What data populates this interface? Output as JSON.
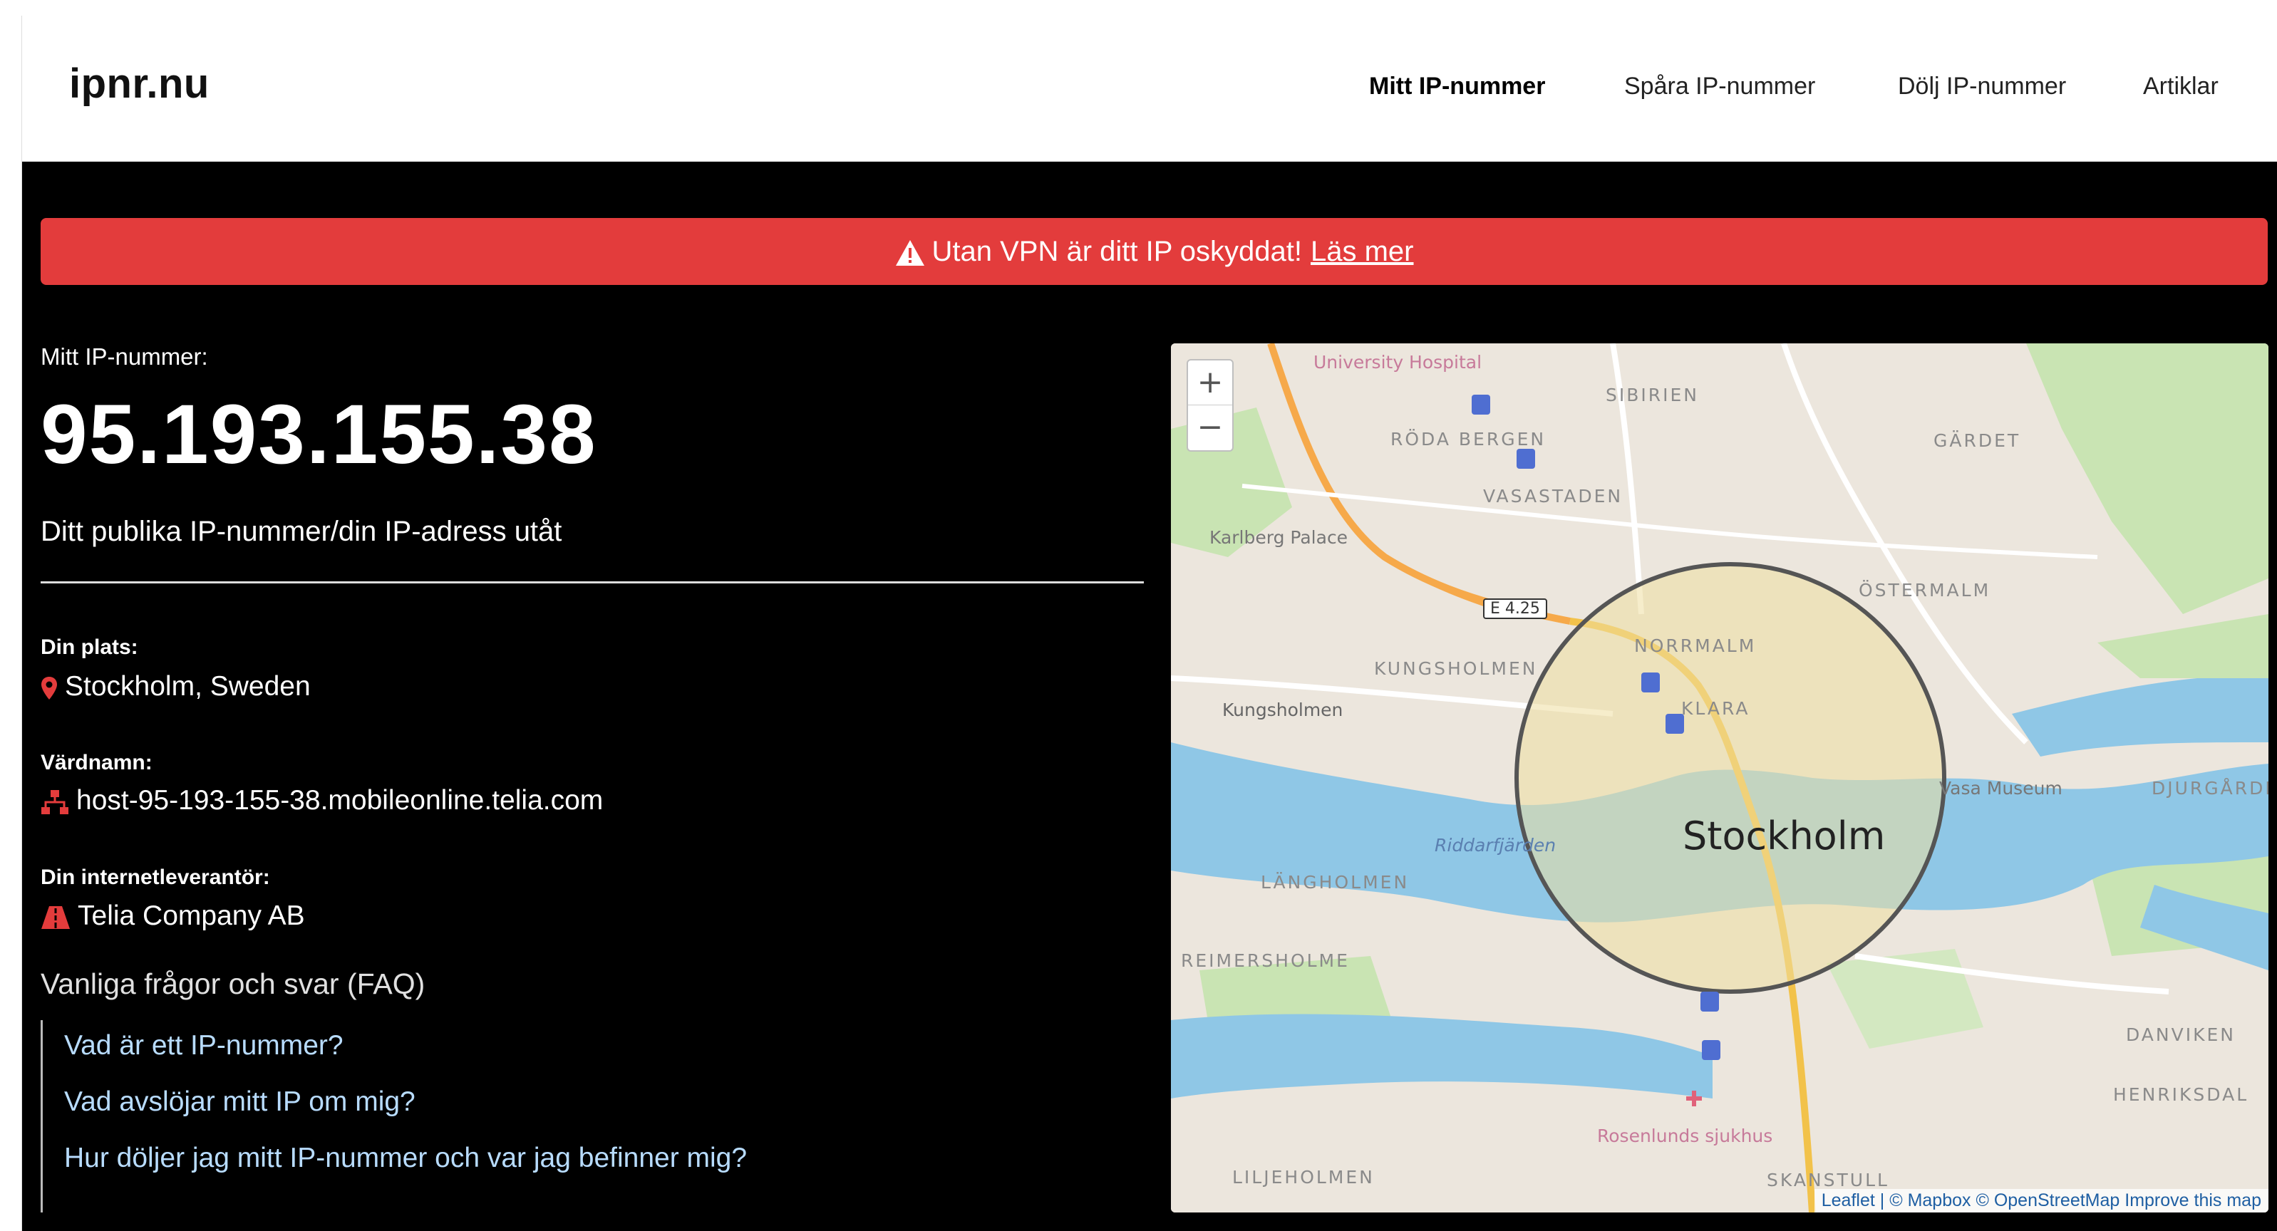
{
  "header": {
    "logo": "ipnr.nu",
    "nav": [
      {
        "label": "Mitt IP-nummer",
        "active": true
      },
      {
        "label": "Spåra IP-nummer",
        "active": false
      },
      {
        "label": "Dölj IP-nummer",
        "active": false
      },
      {
        "label": "Artiklar",
        "active": false
      }
    ]
  },
  "banner": {
    "text": "Utan VPN är ditt IP oskyddat!",
    "link": "Läs mer",
    "icon": "warning-icon",
    "color": "#e33c3c"
  },
  "ip": {
    "label": "Mitt IP-nummer:",
    "value": "95.193.155.38",
    "description": "Ditt publika IP-nummer/din IP-adress utåt"
  },
  "info": [
    {
      "label": "Din plats:",
      "value": "Stockholm, Sweden",
      "icon": "location-pin-icon"
    },
    {
      "label": "Värdnamn:",
      "value": "host-95-193-155-38.mobileonline.telia.com",
      "icon": "network-icon"
    },
    {
      "label": "Din internetleverantör:",
      "value": "Telia Company AB",
      "icon": "road-icon"
    }
  ],
  "faq": {
    "title": "Vanliga frågor och svar (FAQ)",
    "items": [
      "Vad är ett IP-nummer?",
      "Vad avslöjar mitt IP om mig?",
      "Hur döljer jag mitt IP-nummer och var jag befinner mig?"
    ]
  },
  "map": {
    "zoom_in": "+",
    "zoom_out": "−",
    "city": "Stockholm",
    "labels": [
      "University Hospital",
      "SIBIRIEN",
      "RÖDA BERGEN",
      "VASASTADEN",
      "GÄRDET",
      "ÖSTERMALM",
      "NORRMALM",
      "KLARA",
      "KUNGSHOLMEN",
      "Kungsholmen",
      "Karlberg Palace",
      "LÄNGHOLMEN",
      "REIMERSHOLME",
      "LILJEHOLMEN",
      "SKANSTULL",
      "DJURGÅRDEN",
      "HENRIKSDAL",
      "DANVIKEN",
      "Rosenlunds sjukhus",
      "E 4.25",
      "Vasa Museum",
      "Riddarfjärden"
    ],
    "attribution": "Leaflet | © Mapbox © OpenStreetMap Improve this map"
  }
}
